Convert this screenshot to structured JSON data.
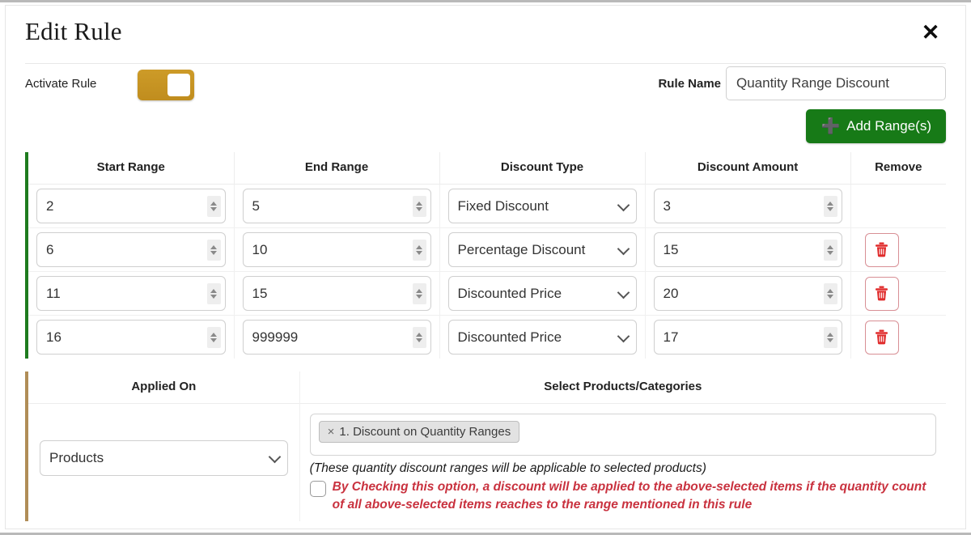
{
  "header": {
    "title": "Edit Rule",
    "close_icon": "close-icon"
  },
  "activate": {
    "label": "Activate Rule",
    "toggle_state": "on",
    "toggle_color": "#c08d1e"
  },
  "rule_name": {
    "label": "Rule Name",
    "value": "Quantity Range Discount",
    "placeholder": "Rule Name"
  },
  "add_range_button": {
    "label": "Add Range(s)",
    "icon": "plus-icon",
    "color": "#177a17"
  },
  "ranges_table": {
    "accent_color": "#1e7b1e",
    "columns": [
      "Start Range",
      "End Range",
      "Discount Type",
      "Discount Amount",
      "Remove"
    ],
    "rows": [
      {
        "start": "2",
        "end": "5",
        "type": "Fixed Discount",
        "amount": "3",
        "removable": false
      },
      {
        "start": "6",
        "end": "10",
        "type": "Percentage Discount",
        "amount": "15",
        "removable": true
      },
      {
        "start": "11",
        "end": "15",
        "type": "Discounted Price",
        "amount": "20",
        "removable": true
      },
      {
        "start": "16",
        "end": "999999",
        "type": "Discounted Price",
        "amount": "17",
        "removable": true
      }
    ],
    "remove_icon": "trash-icon",
    "remove_icon_color": "#e02b2b"
  },
  "applied_section": {
    "accent_color": "#b08d57",
    "applied_on_header": "Applied On",
    "select_header": "Select Products/Categories",
    "applied_on_value": "Products",
    "tags": [
      {
        "remove": "×",
        "label": "1. Discount on Quantity Ranges"
      }
    ],
    "note": "(These quantity discount ranges will be applicable to selected products)",
    "warning_checked": false,
    "warning_text": "By Checking this option, a discount will be applied to the above-selected items if the quantity count of all above-selected items reaches to the range mentioned in this rule",
    "warning_color": "#c9323f"
  }
}
